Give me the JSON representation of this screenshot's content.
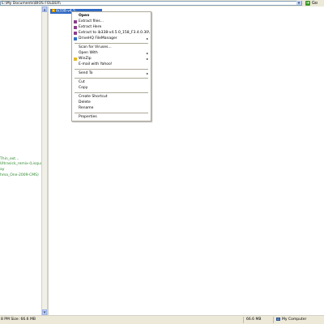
{
  "address_bar": {
    "path": "E:\\My Documents\\BIOS FOLDER\\",
    "go_label": "Go",
    "go_color": "#3b9a24"
  },
  "left_pane": {
    "items": [
      "Thin_ext...",
      "Ultrasick_remix-(Lisquad",
      "ay",
      "hma_One-2009-CMS)"
    ]
  },
  "main_pane": {
    "selected_file": "ib338-v4.5..."
  },
  "context_menu": {
    "open": "Open",
    "extract_files": "Extract files...",
    "extract_here": "Extract Here",
    "extract_to": "Extract to ib338-v4.5.0_158_F3.4.0.30\\",
    "drivehq": "DriveHQ FileManager",
    "scan_viruses": "Scan for Viruses...",
    "open_with": "Open With",
    "winzip": "WinZip",
    "email_yahoo": "E-mail with Yahoo!",
    "send_to": "Send To",
    "cut": "Cut",
    "copy": "Copy",
    "create_shortcut": "Create Shortcut",
    "delete": "Delete",
    "rename": "Rename",
    "properties": "Properties"
  },
  "status_bar": {
    "left_text": "8 PM Size: 66.6 MB",
    "size": "66.6 MB",
    "location": "My Computer"
  },
  "colors": {
    "selection": "#316ac5",
    "tree_text": "#2f8a2f",
    "menu_border": "#aca899",
    "chrome": "#ece9d8"
  }
}
